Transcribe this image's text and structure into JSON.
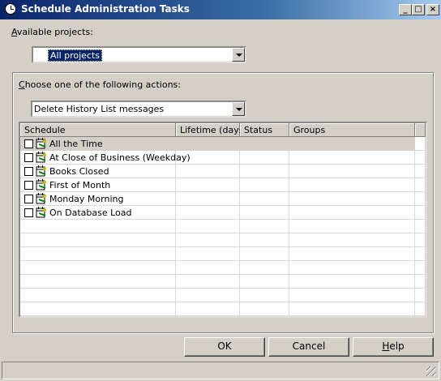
{
  "window": {
    "title": "Schedule Administration Tasks",
    "controls": {
      "minimize": "_",
      "maximize": "□",
      "close": "×"
    }
  },
  "projects": {
    "label_prefix": "",
    "label_accel": "A",
    "label_rest": "vailable projects:",
    "selected": "All projects"
  },
  "actions": {
    "label_accel": "C",
    "label_rest": "hoose one of the following actions:",
    "selected": "Delete History List messages"
  },
  "table": {
    "columns": [
      "Schedule",
      "Lifetime (days)",
      "Status",
      "Groups"
    ],
    "rows": [
      {
        "name": "All the Time",
        "checked": false
      },
      {
        "name": "At Close of Business (Weekday)",
        "checked": false
      },
      {
        "name": "Books Closed",
        "checked": false
      },
      {
        "name": "First of Month",
        "checked": false
      },
      {
        "name": "Monday Morning",
        "checked": false
      },
      {
        "name": "On Database Load",
        "checked": false
      }
    ]
  },
  "buttons": {
    "ok": "OK",
    "cancel": "Cancel",
    "help_accel": "H",
    "help_rest": "elp"
  },
  "icons": {
    "app": "clock-icon",
    "schedule": "schedule-calendar-icon"
  }
}
